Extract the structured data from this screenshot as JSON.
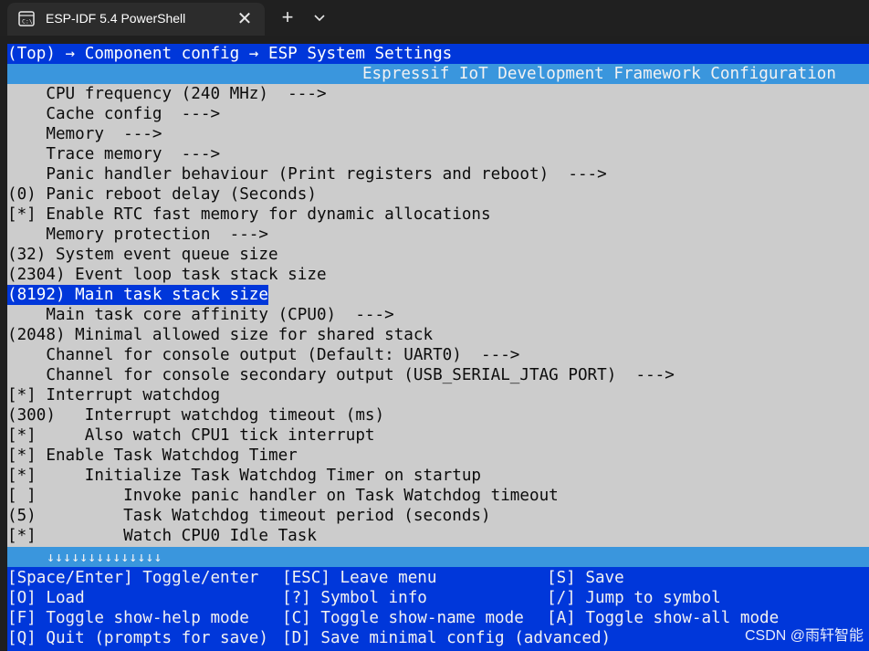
{
  "window": {
    "tab_title": "ESP-IDF 5.4 PowerShell",
    "tab_close": "✕",
    "new_tab": "+",
    "dropdown_icon": "chevron-down-icon"
  },
  "terminal": {
    "breadcrumb": "(Top) → Component config → ESP System Settings",
    "header_title": "Espressif IoT Development Framework Configuration",
    "items": [
      {
        "text": "    CPU frequency (240 MHz)  --->",
        "selected": false
      },
      {
        "text": "    Cache config  --->",
        "selected": false
      },
      {
        "text": "    Memory  --->",
        "selected": false
      },
      {
        "text": "    Trace memory  --->",
        "selected": false
      },
      {
        "text": "    Panic handler behaviour (Print registers and reboot)  --->",
        "selected": false
      },
      {
        "text": "(0) Panic reboot delay (Seconds)",
        "selected": false
      },
      {
        "text": "[*] Enable RTC fast memory for dynamic allocations",
        "selected": false
      },
      {
        "text": "    Memory protection  --->",
        "selected": false
      },
      {
        "text": "(32) System event queue size",
        "selected": false
      },
      {
        "text": "(2304) Event loop task stack size",
        "selected": false
      },
      {
        "text": "(8192) Main task stack size",
        "selected": true
      },
      {
        "text": "    Main task core affinity (CPU0)  --->",
        "selected": false
      },
      {
        "text": "(2048) Minimal allowed size for shared stack",
        "selected": false
      },
      {
        "text": "    Channel for console output (Default: UART0)  --->",
        "selected": false
      },
      {
        "text": "    Channel for console secondary output (USB_SERIAL_JTAG PORT)  --->",
        "selected": false
      },
      {
        "text": "[*] Interrupt watchdog",
        "selected": false
      },
      {
        "text": "(300)   Interrupt watchdog timeout (ms)",
        "selected": false
      },
      {
        "text": "[*]     Also watch CPU1 tick interrupt",
        "selected": false
      },
      {
        "text": "[*] Enable Task Watchdog Timer",
        "selected": false
      },
      {
        "text": "[*]     Initialize Task Watchdog Timer on startup",
        "selected": false
      },
      {
        "text": "[ ]         Invoke panic handler on Task Watchdog timeout",
        "selected": false
      },
      {
        "text": "(5)         Task Watchdog timeout period (seconds)",
        "selected": false
      },
      {
        "text": "[*]         Watch CPU0 Idle Task",
        "selected": false
      }
    ],
    "scroll_indicator": "↓↓↓↓↓↓↓↓↓↓↓↓↓↓",
    "keys": [
      [
        "[Space/Enter] Toggle/enter",
        "[ESC] Leave menu",
        "[S] Save"
      ],
      [
        "[O] Load",
        "[?] Symbol info",
        "[/] Jump to symbol"
      ],
      [
        "[F] Toggle show-help mode",
        "[C] Toggle show-name mode",
        "[A] Toggle show-all mode"
      ],
      [
        "[Q] Quit (prompts for save)",
        "[D] Save minimal config (advanced)",
        ""
      ]
    ]
  },
  "watermark": "CSDN @雨轩智能",
  "colors": {
    "terminal_blue": "#0037da",
    "header_cyan": "#3a96dd",
    "menu_gray": "#cccccc"
  }
}
